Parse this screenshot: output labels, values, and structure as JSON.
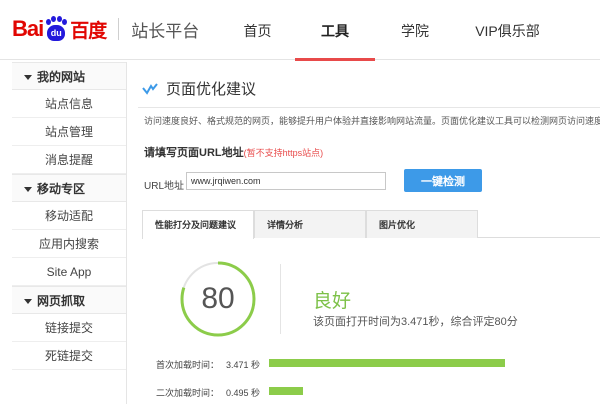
{
  "header": {
    "logo_text_bai": "Bai",
    "logo_text_du": "du",
    "logo_text_cn": "百度",
    "site_title": "站长平台",
    "nav": [
      {
        "label": "首页",
        "active": false
      },
      {
        "label": "工具",
        "active": true
      },
      {
        "label": "学院",
        "active": false
      },
      {
        "label": "VIP俱乐部",
        "active": false
      }
    ]
  },
  "sidebar": {
    "groups": [
      {
        "label": "我的网站",
        "items": [
          "站点信息",
          "站点管理",
          "消息提醒"
        ]
      },
      {
        "label": "移动专区",
        "items": [
          "移动适配",
          "应用内搜索",
          "Site App"
        ]
      },
      {
        "label": "网页抓取",
        "items": [
          "链接提交",
          "死链提交"
        ]
      }
    ]
  },
  "main": {
    "title": "页面优化建议",
    "description": "访问速度良好、格式规范的网页，能够提升用户体验并直接影响网站流量。页面优化建议工具可以检测网页访问速度并给",
    "prompt": "请填写页面URL地址",
    "prompt_note": "(暂不支持https站点)",
    "url_label": "URL地址",
    "url_value": "www.jrqiwen.com",
    "detect_button": "一键检测",
    "tabs": [
      {
        "label": "性能打分及问题建议",
        "active": true
      },
      {
        "label": "详情分析",
        "active": false
      },
      {
        "label": "图片优化",
        "active": false
      }
    ],
    "score": "80",
    "score_fraction": 0.8,
    "grade": "良好",
    "summary": "该页面打开时间为3.471秒，综合评定80分",
    "metrics": [
      {
        "label": "首次加载时间：",
        "value": "3.471 秒",
        "seconds": 3.471
      },
      {
        "label": "二次加载时间：",
        "value": "0.495 秒",
        "seconds": 0.495
      }
    ],
    "colors": {
      "accent_green": "#8ccc4a",
      "button_blue": "#3d9ae8",
      "nav_underline": "#e84a4a"
    }
  }
}
